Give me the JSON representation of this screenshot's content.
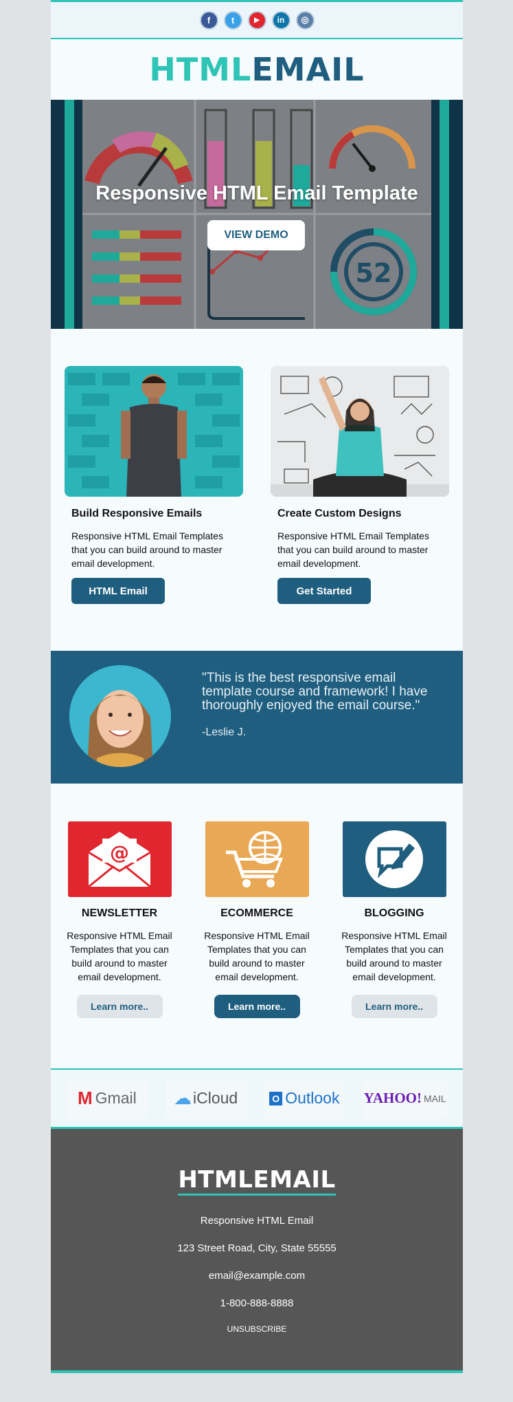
{
  "social": [
    "f",
    "t",
    "▶",
    "in",
    "◎"
  ],
  "logo": {
    "part1": "HTML",
    "part2": "EMAIL"
  },
  "hero": {
    "title": "Responsive HTML Email Template",
    "button": "VIEW DEMO",
    "gauge_number": "52"
  },
  "cards": [
    {
      "title": "Build Responsive Emails",
      "text": "Responsive HTML Email Templates that you can build around to master email development.",
      "button": "HTML Email"
    },
    {
      "title": "Create Custom Designs",
      "text": "Responsive HTML Email Templates that you can build around to master email development.",
      "button": "Get Started"
    }
  ],
  "testimonial": {
    "quote": "\"This is the best responsive email template course and framework! I have thoroughly enjoyed the email course.\"",
    "author": "-Leslie J."
  },
  "features": [
    {
      "title": "NEWSLETTER",
      "text": "Responsive HTML Email Templates that you can build around to master email development.",
      "button": "Learn more..",
      "color": "#e0262f"
    },
    {
      "title": "ECOMMERCE",
      "text": "Responsive HTML Email Templates that you can build around to master email development.",
      "button": "Learn more..",
      "color": "#e8a855"
    },
    {
      "title": "BLOGGING",
      "text": "Responsive HTML Email Templates that you can build around to master email development.",
      "button": "Learn more..",
      "color": "#1f5e7e"
    }
  ],
  "clients": [
    "Gmail",
    "iCloud",
    "Outlook",
    "YAHOO!",
    "MAIL"
  ],
  "footer": {
    "logo": "HTMLEMAIL",
    "tagline": "Responsive HTML Email",
    "address": "123 Street Road, City, State 55555",
    "email": "email@example.com",
    "phone": "1-800-888-8888",
    "unsubscribe": "UNSUBSCRIBE"
  },
  "colors": {
    "accent": "#2ec4b6",
    "brand": "#1f5e7e",
    "footer_bg": "#565656"
  }
}
